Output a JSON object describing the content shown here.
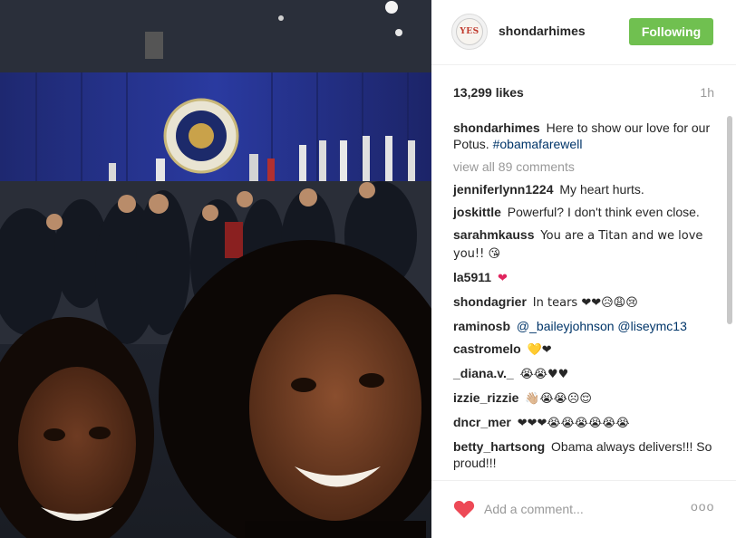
{
  "post": {
    "username": "shondarhimes",
    "avatar_text": "YES",
    "follow_label": "Following",
    "likes": "13,299 likes",
    "time": "1h"
  },
  "caption": {
    "user": "shondarhimes",
    "text": "Here to show our love for our Potus.",
    "hashtag": "#obamafarewell"
  },
  "view_all": "view all 89 comments",
  "comments": [
    {
      "user": "jenniferlynn1224",
      "text": "My heart hurts."
    },
    {
      "user": "joskittle",
      "text": "Powerful? I don't think even close."
    },
    {
      "user": "sarahmkauss",
      "text": "You are a Titan and we love you!! 😘"
    },
    {
      "user": "la5911",
      "text": "❤"
    },
    {
      "user": "shondagrier",
      "text": "In tears ❤❤😥😩😢"
    },
    {
      "user": "raminosb",
      "text": "@_baileyjohnson @liseymc13"
    },
    {
      "user": "castromelo",
      "text": "💛❤"
    },
    {
      "user": "_diana.v._",
      "text": "😭😭♥♥"
    },
    {
      "user": "izzie_rizzie",
      "text": "👋🏼😭😭☹😌"
    },
    {
      "user": "dncr_mer",
      "text": "❤❤❤😭😭😭😭😭😭"
    },
    {
      "user": "betty_hartsong",
      "text": "Obama always delivers!!! So proud!!!"
    }
  ],
  "footer": {
    "comment_placeholder": "Add a comment...",
    "more": "ooo"
  },
  "colors": {
    "follow_button": "#70c050",
    "like_heart": "#ed4956",
    "link": "#003569"
  },
  "icons": {
    "like": "heart-icon",
    "more": "more-options-icon"
  }
}
